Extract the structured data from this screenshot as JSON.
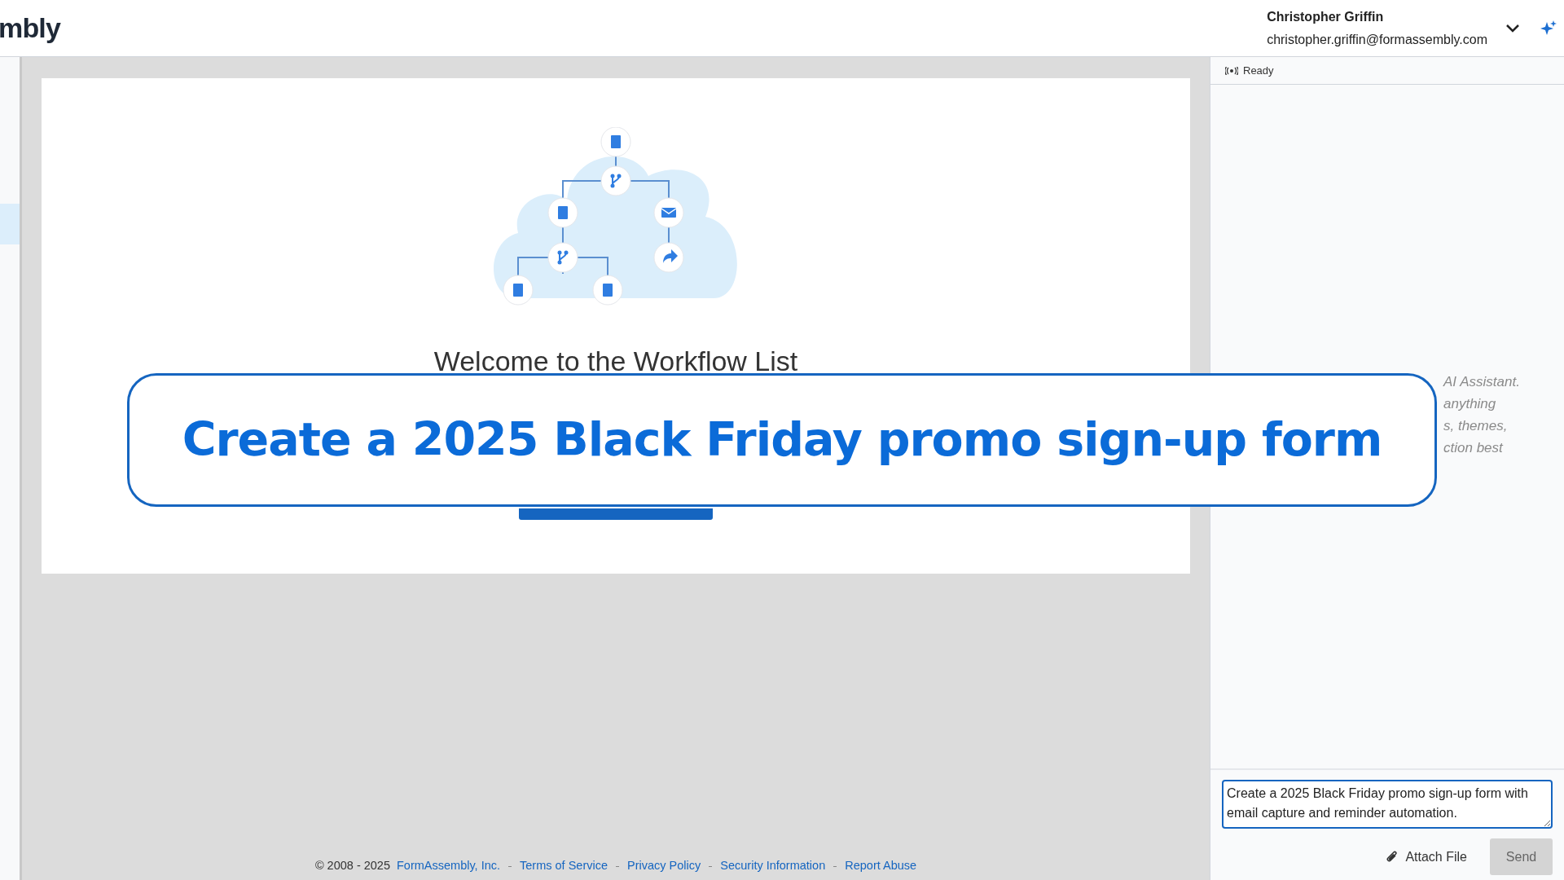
{
  "header": {
    "logo_text": "mbly",
    "user_name": "Christopher Griffin",
    "user_email": "christopher.griffin@formassembly.com"
  },
  "main": {
    "heading": "Welcome to the Workflow List",
    "footer": {
      "copyright": "© 2008 - 2025",
      "links": [
        "FormAssembly, Inc.",
        "Terms of Service",
        "Privacy Policy",
        "Security Information",
        "Report Abuse"
      ]
    }
  },
  "assistant": {
    "status": "Ready",
    "intro_lines": [
      "AI Assistant.",
      "anything",
      "s, themes,",
      "ction best"
    ],
    "input": {
      "value": "Create a 2025 Black Friday promo sign-up form with email capture and reminder automation."
    },
    "attach_label": "Attach File",
    "send": {
      "label": "Send",
      "disabled": true
    }
  },
  "overlay": {
    "caption": "Create a 2025 Black Friday promo sign-up form"
  }
}
